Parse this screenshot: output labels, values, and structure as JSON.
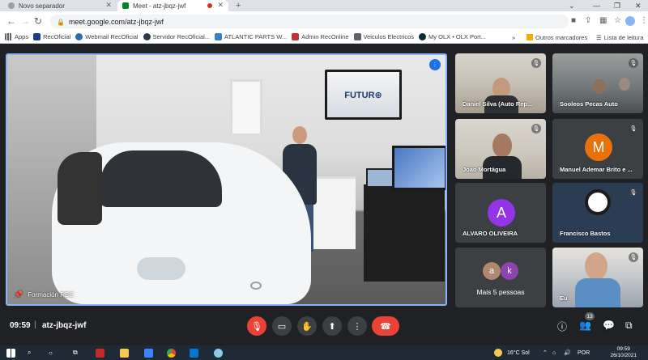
{
  "browser": {
    "tabs": [
      {
        "title": "Novo separador"
      },
      {
        "title": "Meet - atz-jbqz-jwf"
      }
    ],
    "url": "meet.google.com/atz-jbqz-jwf",
    "bookmarks": [
      {
        "label": "Apps",
        "icon": "apps-grid-icon",
        "color": "#5f6368"
      },
      {
        "label": "RecOficial",
        "icon": "recoficial-icon",
        "color": "#1a3a8a"
      },
      {
        "label": "Webmail RecOficial",
        "icon": "webmail-icon",
        "color": "#2b6cb0"
      },
      {
        "label": "Servidor RecOficial...",
        "icon": "server-icon",
        "color": "#2d3748"
      },
      {
        "label": "ATLANTIC PARTS W...",
        "icon": "shield-icon",
        "color": "#3182ce"
      },
      {
        "label": "Admin RecOnline",
        "icon": "admin-icon",
        "color": "#c53030"
      },
      {
        "label": "Veiculos Electricos",
        "icon": "folder-icon",
        "color": "#5f6368"
      },
      {
        "label": "My OLX • OLX Port...",
        "icon": "olx-icon",
        "color": "#002f34"
      }
    ],
    "bookmarks_right": {
      "more": "»",
      "other_bookmarks": "Outros marcadores",
      "reading_list": "Lista de leitura"
    }
  },
  "meeting": {
    "main_speaker": "Formación REC",
    "tv_text": "FUTUR⊕",
    "participants": [
      {
        "name": "Daniel Silva (Auto Rep...",
        "type": "video",
        "muted": true
      },
      {
        "name": "Sooleos Pecas Auto",
        "type": "video",
        "muted": true
      },
      {
        "name": "Joao Mortágua",
        "type": "video",
        "muted": true
      },
      {
        "name": "Manuel Ademar Brito e ...",
        "type": "avatar",
        "initial": "M",
        "color": "#e8710a",
        "muted": true
      },
      {
        "name": "ALVARO OLIVEIRA",
        "type": "avatar",
        "initial": "A",
        "color": "#9334e6",
        "muted": false
      },
      {
        "name": "Francisco Bastos",
        "type": "video",
        "muted": true
      },
      {
        "name": "Mais 5 pessoas",
        "type": "more",
        "initials": [
          "a",
          "k"
        ],
        "colors": [
          "#b0876f",
          "#8e44ad"
        ]
      },
      {
        "name": "Eu",
        "type": "video",
        "muted": true
      }
    ],
    "time": "09:59",
    "separator": "|",
    "code": "atz-jbqz-jwf",
    "participant_count": "13"
  },
  "taskbar": {
    "weather": "16°C Sol",
    "language": "POR",
    "time": "09:59",
    "date": "26/10/2021"
  }
}
